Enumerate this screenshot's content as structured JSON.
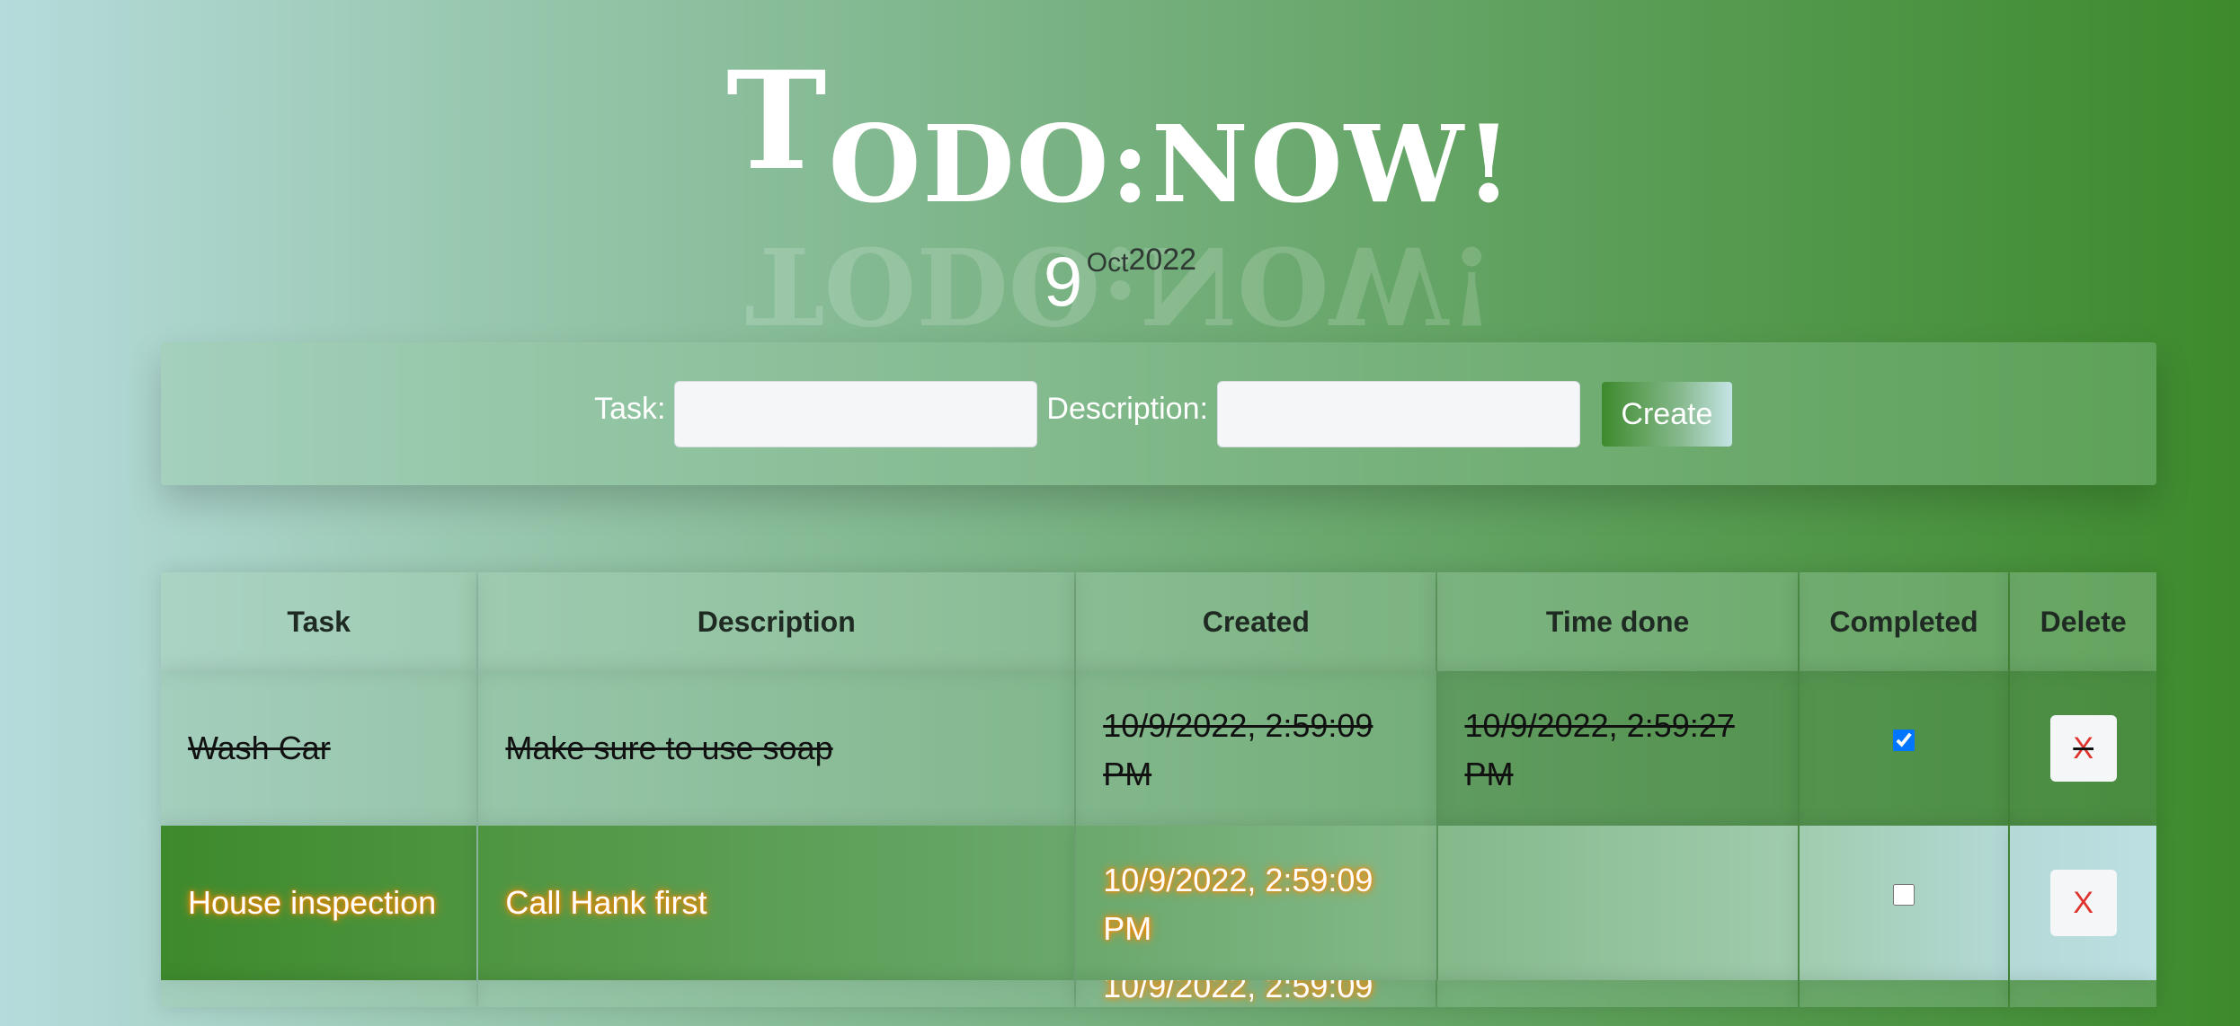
{
  "header": {
    "title_first_letter": "T",
    "title_rest": "ODO:NOW!",
    "title_bang": "!",
    "reflection_text": "TODO:NOW!",
    "date_day": "9",
    "date_month": "Oct",
    "date_year": "2022"
  },
  "form": {
    "task_label": "Task:",
    "task_value": "",
    "description_label": "Description:",
    "description_value": "",
    "create_button": "Create"
  },
  "table": {
    "headers": {
      "task": "Task",
      "description": "Description",
      "created": "Created",
      "time_done": "Time done",
      "completed": "Completed",
      "delete": "Delete"
    },
    "rows": [
      {
        "task": "Wash Car",
        "description": "Make sure to use soap",
        "created": "10/9/2022, 2:59:09 PM",
        "time_done": "10/9/2022, 2:59:27 PM",
        "completed": true,
        "delete_label": "X"
      },
      {
        "task": "House inspection",
        "description": "Call Hank first",
        "created": "10/9/2022, 2:59:09 PM",
        "time_done": "",
        "completed": false,
        "delete_label": "X"
      }
    ],
    "partial_row_created": "10/9/2022, 2:59:09"
  },
  "colors": {
    "glow": "#ff8a00",
    "delete_x": "#e0332e",
    "accent_green": "#3d8a2c",
    "light_teal": "#b6dbdc"
  }
}
